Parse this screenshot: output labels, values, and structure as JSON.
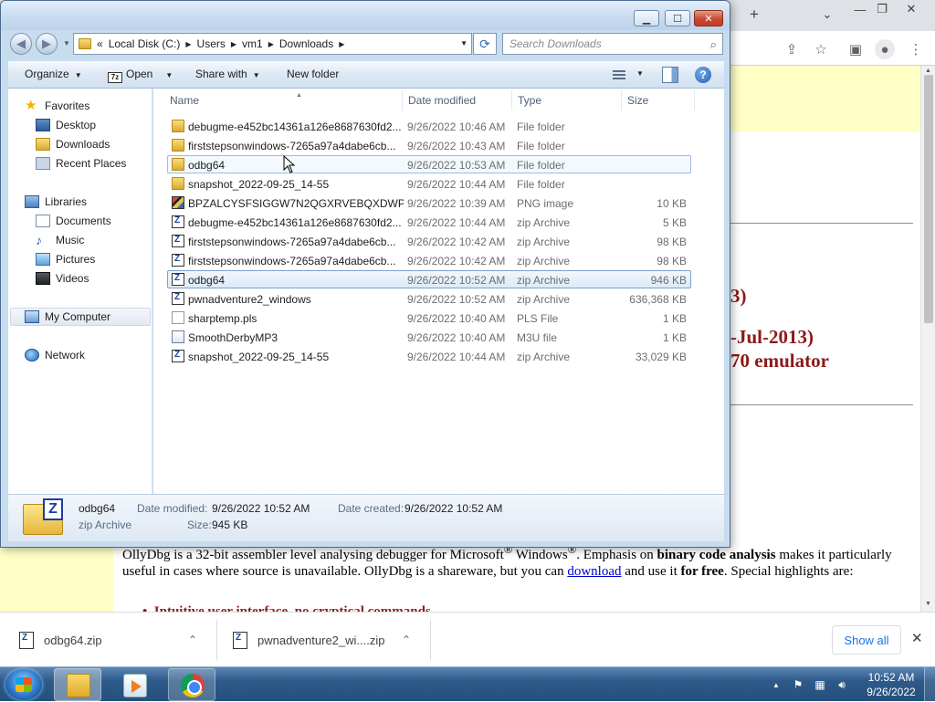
{
  "browser": {
    "page": {
      "heading_a": "3)",
      "heading_b": "-Jul-2013)",
      "heading_c": "70 emulator",
      "para_1": "OllyDbg is a 32-bit assembler level analysing debugger for Microsoft",
      "para_2": " Windows",
      "para_3": ". Emphasis on ",
      "para_bold": "binary code analysis",
      "para_4": " makes it particularly useful in cases where source is unavailable. OllyDbg is a shareware, but you can ",
      "para_link": "download",
      "para_5": " and use it ",
      "para_bold2": "for free",
      "para_6": ". Special highlights are:",
      "bullet": "Intuitive user interface, no cryptical commands"
    },
    "downloads": [
      {
        "name": "odbg64.zip"
      },
      {
        "name": "pwnadventure2_wi....zip"
      }
    ],
    "show_all": "Show all"
  },
  "explorer": {
    "address": {
      "overflow": "«",
      "segments": [
        "Local Disk (C:)",
        "Users",
        "vm1",
        "Downloads"
      ]
    },
    "search_placeholder": "Search Downloads",
    "commands": {
      "organize": "Organize",
      "open": "Open",
      "share_with": "Share with",
      "new_folder": "New folder"
    },
    "nav": {
      "favorites": "Favorites",
      "desktop": "Desktop",
      "downloads": "Downloads",
      "recent_places": "Recent Places",
      "libraries": "Libraries",
      "documents": "Documents",
      "music": "Music",
      "pictures": "Pictures",
      "videos": "Videos",
      "my_computer": "My Computer",
      "network": "Network"
    },
    "columns": {
      "name": "Name",
      "date_modified": "Date modified",
      "type": "Type",
      "size": "Size"
    },
    "files": [
      {
        "name": "debugme-e452bc14361a126e8687630fd2...",
        "date": "9/26/2022 10:46 AM",
        "type": "File folder",
        "size": "",
        "icon": "folder-icon"
      },
      {
        "name": "firststepsonwindows-7265a97a4dabe6cb...",
        "date": "9/26/2022 10:43 AM",
        "type": "File folder",
        "size": "",
        "icon": "folder-icon"
      },
      {
        "name": "odbg64",
        "date": "9/26/2022 10:53 AM",
        "type": "File folder",
        "size": "",
        "icon": "folder-icon"
      },
      {
        "name": "snapshot_2022-09-25_14-55",
        "date": "9/26/2022 10:44 AM",
        "type": "File folder",
        "size": "",
        "icon": "folder-icon"
      },
      {
        "name": "BPZALCYSFSIGGW7N2QGXRVEBQXDWP....",
        "date": "9/26/2022 10:39 AM",
        "type": "PNG image",
        "size": "10 KB",
        "icon": "png-image-icon"
      },
      {
        "name": "debugme-e452bc14361a126e8687630fd2...",
        "date": "9/26/2022 10:44 AM",
        "type": "zip Archive",
        "size": "5 KB",
        "icon": "zip-archive-icon"
      },
      {
        "name": "firststepsonwindows-7265a97a4dabe6cb...",
        "date": "9/26/2022 10:42 AM",
        "type": "zip Archive",
        "size": "98 KB",
        "icon": "zip-archive-icon"
      },
      {
        "name": "firststepsonwindows-7265a97a4dabe6cb...",
        "date": "9/26/2022 10:42 AM",
        "type": "zip Archive",
        "size": "98 KB",
        "icon": "zip-archive-icon"
      },
      {
        "name": "odbg64",
        "date": "9/26/2022 10:52 AM",
        "type": "zip Archive",
        "size": "946 KB",
        "icon": "zip-archive-icon"
      },
      {
        "name": "pwnadventure2_windows",
        "date": "9/26/2022 10:52 AM",
        "type": "zip Archive",
        "size": "636,368 KB",
        "icon": "zip-archive-icon"
      },
      {
        "name": "sharptemp.pls",
        "date": "9/26/2022 10:40 AM",
        "type": "PLS File",
        "size": "1 KB",
        "icon": "file-icon"
      },
      {
        "name": "SmoothDerbyMP3",
        "date": "9/26/2022 10:40 AM",
        "type": "M3U file",
        "size": "1 KB",
        "icon": "playlist-icon"
      },
      {
        "name": "snapshot_2022-09-25_14-55",
        "date": "9/26/2022 10:44 AM",
        "type": "zip Archive",
        "size": "33,029 KB",
        "icon": "zip-archive-icon"
      }
    ],
    "details": {
      "name": "odbg64",
      "type": "zip Archive",
      "date_modified_label": "Date modified:",
      "date_modified": "9/26/2022 10:52 AM",
      "date_created_label": "Date created:",
      "date_created": "9/26/2022 10:52 AM",
      "size_label": "Size:",
      "size": "945 KB"
    }
  },
  "taskbar": {
    "time": "10:52 AM",
    "date": "9/26/2022"
  }
}
